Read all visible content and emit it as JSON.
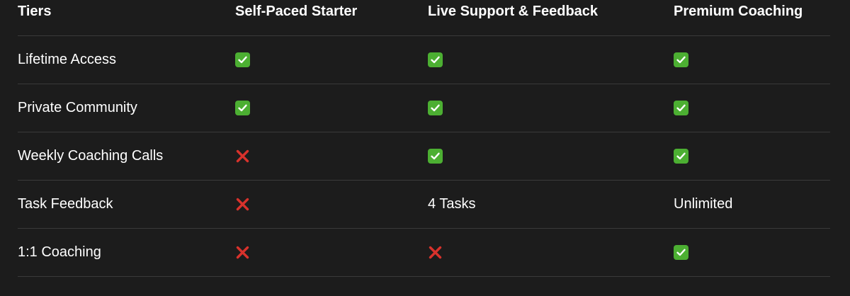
{
  "colors": {
    "background": "#1c1c1c",
    "text": "#ffffff",
    "divider": "#3a3a3a",
    "check": "#4caf32",
    "cross": "#d8322c"
  },
  "table": {
    "headers": [
      "Tiers",
      "Self-Paced Starter",
      "Live Support & Feedback",
      "Premium Coaching"
    ],
    "rows": [
      {
        "feature": "Lifetime Access",
        "cells": [
          {
            "type": "icon",
            "icon": "check-icon"
          },
          {
            "type": "icon",
            "icon": "check-icon"
          },
          {
            "type": "icon",
            "icon": "check-icon"
          }
        ]
      },
      {
        "feature": "Private Community",
        "cells": [
          {
            "type": "icon",
            "icon": "check-icon"
          },
          {
            "type": "icon",
            "icon": "check-icon"
          },
          {
            "type": "icon",
            "icon": "check-icon"
          }
        ]
      },
      {
        "feature": "Weekly Coaching Calls",
        "cells": [
          {
            "type": "icon",
            "icon": "cross-icon"
          },
          {
            "type": "icon",
            "icon": "check-icon"
          },
          {
            "type": "icon",
            "icon": "check-icon"
          }
        ]
      },
      {
        "feature": "Task Feedback",
        "cells": [
          {
            "type": "icon",
            "icon": "cross-icon"
          },
          {
            "type": "text",
            "text": "4 Tasks"
          },
          {
            "type": "text",
            "text": "Unlimited"
          }
        ]
      },
      {
        "feature": "1:1 Coaching",
        "cells": [
          {
            "type": "icon",
            "icon": "cross-icon"
          },
          {
            "type": "icon",
            "icon": "cross-icon"
          },
          {
            "type": "icon",
            "icon": "check-icon"
          }
        ]
      }
    ]
  }
}
